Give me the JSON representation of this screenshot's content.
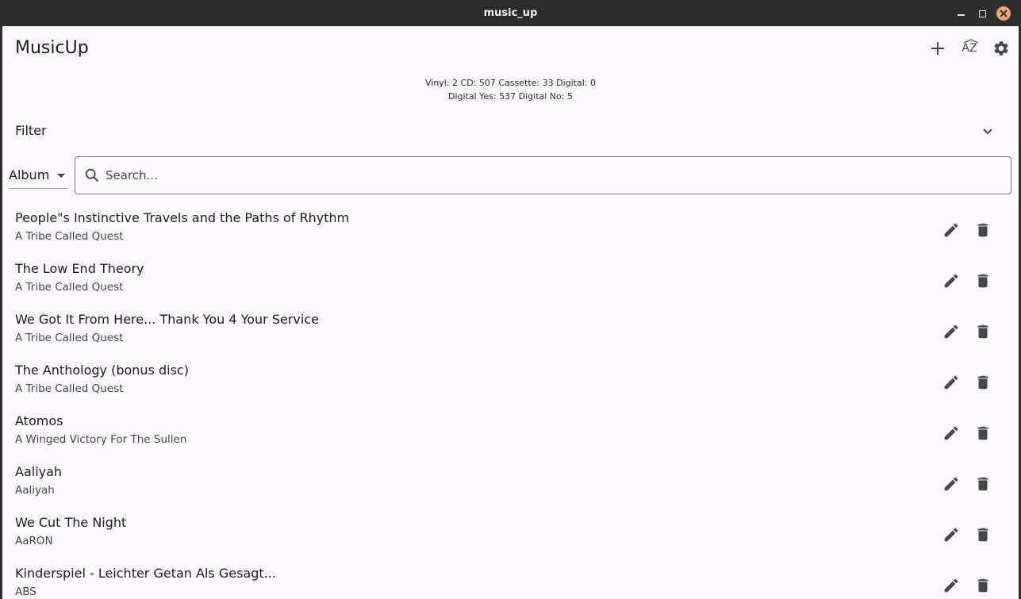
{
  "window": {
    "title": "music_up"
  },
  "app": {
    "title": "MusicUp"
  },
  "toolbar": {
    "sort_label": "AZ"
  },
  "stats": {
    "line1": "Vinyl: 2  CD: 507  Cassette: 33  Digital: 0",
    "line2": "Digital Yes: 537  Digital No: 5"
  },
  "filter": {
    "label": "Filter"
  },
  "search": {
    "field_selected": "Album",
    "placeholder": "Search...",
    "value": ""
  },
  "albums": [
    {
      "title": "People\"s Instinctive Travels and the Paths of Rhythm",
      "artist": "A Tribe Called Quest"
    },
    {
      "title": "The Low End Theory",
      "artist": "A Tribe Called Quest"
    },
    {
      "title": "We Got It From Here... Thank You 4 Your Service",
      "artist": "A Tribe Called Quest"
    },
    {
      "title": "The Anthology (bonus disc)",
      "artist": "A Tribe Called Quest"
    },
    {
      "title": "Atomos",
      "artist": "A Winged Victory For The Sullen"
    },
    {
      "title": "Aaliyah",
      "artist": "Aaliyah"
    },
    {
      "title": "We Cut The Night",
      "artist": "AaRON"
    },
    {
      "title": "Kinderspiel - Leichter Getan Als Gesagt...",
      "artist": "ABS"
    }
  ],
  "colors": {
    "background": "#fdf8fd",
    "titlebar": "#2c2c2c",
    "icon": "#45464f",
    "text": "#1c1b1f",
    "close": "#e9a47d"
  },
  "icons": [
    "minimize-icon",
    "maximize-icon",
    "close-icon",
    "add-icon",
    "sort-az-icon",
    "gear-icon",
    "chevron-down-icon",
    "dropdown-arrow-icon",
    "search-icon",
    "pencil-icon",
    "trash-icon"
  ]
}
